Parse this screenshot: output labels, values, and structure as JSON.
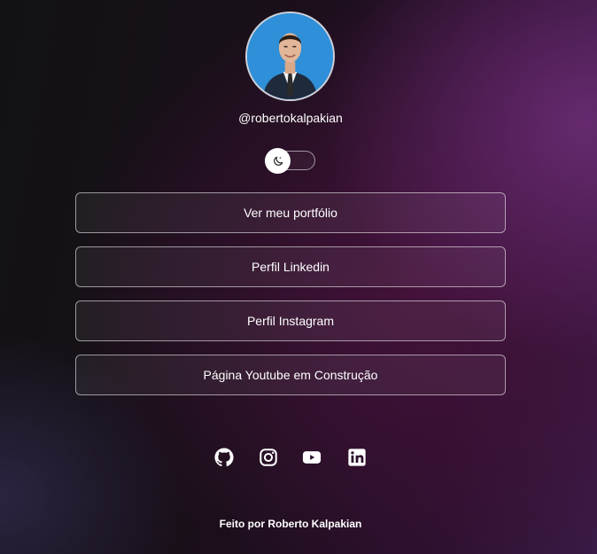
{
  "profile": {
    "username": "@robertokalpakian",
    "avatar_alt": "Roberto Kalpakian"
  },
  "theme_toggle": {
    "icon": "moon-icon",
    "state": "dark"
  },
  "links": [
    {
      "label": "Ver meu portfólio"
    },
    {
      "label": "Perfil Linkedin"
    },
    {
      "label": "Perfil Instagram"
    },
    {
      "label": "Página Youtube em Construção"
    }
  ],
  "socials": [
    {
      "icon": "github-icon"
    },
    {
      "icon": "instagram-icon"
    },
    {
      "icon": "youtube-icon"
    },
    {
      "icon": "linkedin-icon"
    }
  ],
  "footer": {
    "text": "Feito por Roberto Kalpakian"
  },
  "colors": {
    "text": "#ffffff",
    "button_border": "#8c7a8f",
    "avatar_bg": "#2f8fd8"
  }
}
